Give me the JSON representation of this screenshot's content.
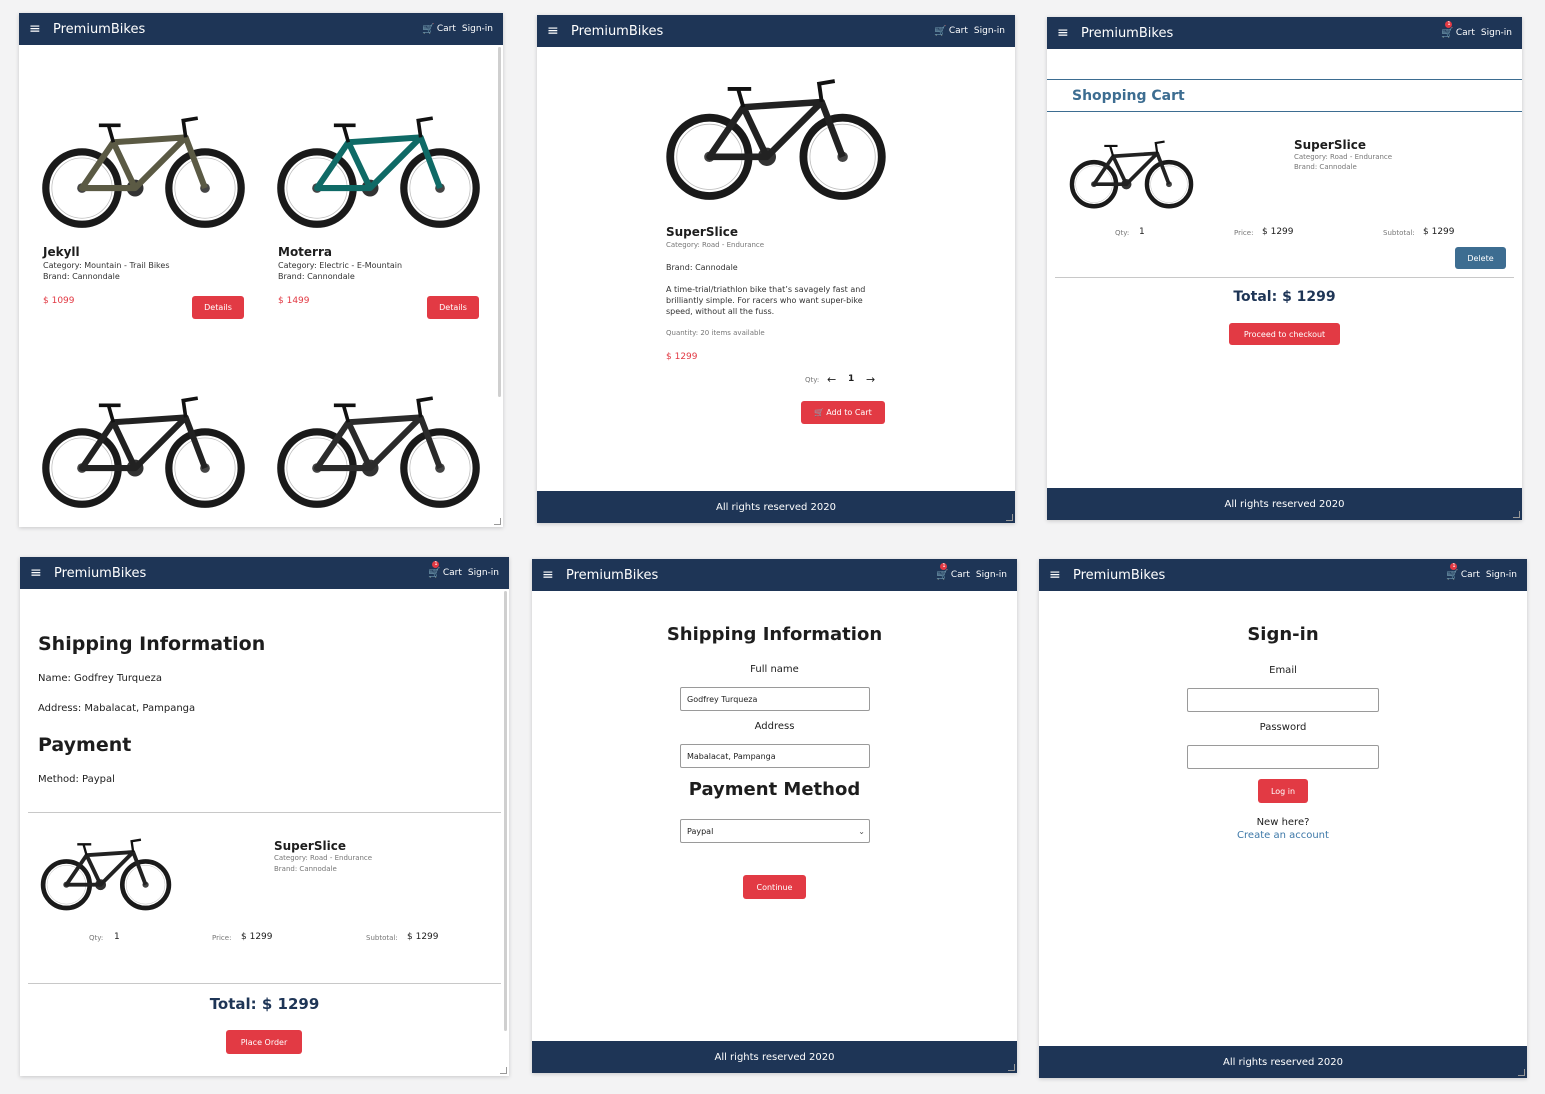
{
  "nav": {
    "brand": "PremiumBikes",
    "menu_icon": "hamburger-menu-icon",
    "cart_label": "Cart",
    "cart_icon": "shopping-cart-icon",
    "signin_label": "Sign-in",
    "cart_badge": "1"
  },
  "footer": {
    "text": "All rights reserved 2020"
  },
  "colors": {
    "navy": "#1e3556",
    "accent_red": "#e23a44",
    "button_blue": "#3d6d91"
  },
  "catalog": {
    "products": [
      {
        "name": "Jekyll",
        "category": "Category: Mountain - Trail Bikes",
        "brand": "Brand: Cannondale",
        "price": "$ 1099",
        "button": "Details",
        "frame_color": "#5b5a44"
      },
      {
        "name": "Moterra",
        "category": "Category: Electric - E-Mountain",
        "brand": "Brand: Cannondale",
        "price": "$ 1499",
        "button": "Details",
        "frame_color": "#0f6a66"
      },
      {
        "frame_color": "#222222"
      },
      {
        "frame_color": "#2b2b2b"
      }
    ]
  },
  "detail": {
    "name": "SuperSlice",
    "category": "Category: Road - Endurance",
    "brand": "Brand: Cannodale",
    "description": "A time-trial/triathlon bike that’s savagely fast and brilliantly simple. For racers who want super-bike speed, without all the fuss.",
    "quantity_note": "Quantity: 20 items available",
    "price": "$ 1299",
    "qty_label": "Qty:",
    "qty_value": "1",
    "qty_decrease": "←",
    "qty_increase": "→",
    "add_to_cart": "Add to Cart"
  },
  "cart": {
    "title": "Shopping Cart",
    "item": {
      "name": "SuperSlice",
      "category": "Category: Road - Endurance",
      "brand": "Brand: Cannodale",
      "qty_label": "Qty:",
      "qty": "1",
      "price_label": "Price:",
      "price": "$ 1299",
      "subtotal_label": "Subtotal:",
      "subtotal": "$ 1299",
      "delete": "Delete"
    },
    "total": "Total: $ 1299",
    "checkout": "Proceed to checkout"
  },
  "review": {
    "shipping_title": "Shipping Information",
    "name_line": "Name: Godfrey Turqueza",
    "address_line": "Address: Mabalacat, Pampanga",
    "payment_title": "Payment",
    "method_line": "Method: Paypal",
    "item": {
      "name": "SuperSlice",
      "category": "Category: Road - Endurance",
      "brand": "Brand: Cannodale",
      "qty_label": "Qty:",
      "qty": "1",
      "price_label": "Price:",
      "price": "$ 1299",
      "subtotal_label": "Subtotal:",
      "subtotal": "$ 1299"
    },
    "total": "Total: $ 1299",
    "place_order": "Place Order"
  },
  "shipping_form": {
    "title": "Shipping Information",
    "fullname_label": "Full name",
    "fullname_value": "Godfrey Turqueza",
    "address_label": "Address",
    "address_value": "Mabalacat, Pampanga",
    "payment_title": "Payment Method",
    "payment_value": "Paypal",
    "continue": "Continue"
  },
  "signin": {
    "title": "Sign-in",
    "email_label": "Email",
    "email_value": "",
    "password_label": "Password",
    "password_value": "",
    "login": "Log in",
    "new_here": "New here?",
    "create_account": "Create an account"
  }
}
